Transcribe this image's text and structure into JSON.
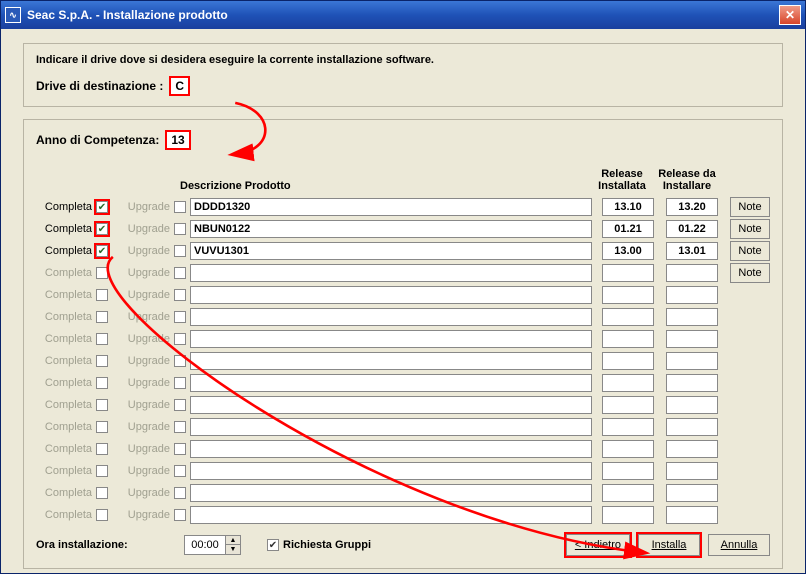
{
  "window": {
    "title": "Seac S.p.A.        -    Installazione prodotto",
    "icon": "app-icon"
  },
  "instruction": "Indicare il drive dove si desidera eseguire la corrente installazione software.",
  "drive": {
    "label": "Drive di destinazione :",
    "value": "C"
  },
  "anno": {
    "label": "Anno di Competenza:",
    "value": "13"
  },
  "headers": {
    "desc": "Descrizione Prodotto",
    "releaseInstallata": "Release\nInstallata",
    "releaseDaInstallare": "Release da\nInstallare"
  },
  "row_labels": {
    "completa": "Completa",
    "upgrade": "Upgrade",
    "note": "Note"
  },
  "rows": [
    {
      "completa": true,
      "completa_red": true,
      "upgrade": false,
      "upgrade_disabled": true,
      "desc": "DDDD1320",
      "rel": "13.10",
      "relda": "13.20",
      "note": true,
      "enabled": true
    },
    {
      "completa": true,
      "completa_red": true,
      "upgrade": false,
      "upgrade_disabled": true,
      "desc": "NBUN0122",
      "rel": "01.21",
      "relda": "01.22",
      "note": true,
      "enabled": true
    },
    {
      "completa": true,
      "completa_red": true,
      "upgrade": false,
      "upgrade_disabled": true,
      "desc": "VUVU1301",
      "rel": "13.00",
      "relda": "13.01",
      "note": true,
      "enabled": true
    },
    {
      "completa": false,
      "upgrade": false,
      "desc": "",
      "rel": "",
      "relda": "",
      "note": true,
      "enabled": false
    },
    {
      "completa": false,
      "upgrade": false,
      "desc": "",
      "rel": "",
      "relda": "",
      "note": false,
      "enabled": false
    },
    {
      "completa": false,
      "upgrade": false,
      "desc": "",
      "rel": "",
      "relda": "",
      "note": false,
      "enabled": false
    },
    {
      "completa": false,
      "upgrade": false,
      "desc": "",
      "rel": "",
      "relda": "",
      "note": false,
      "enabled": false
    },
    {
      "completa": false,
      "upgrade": false,
      "desc": "",
      "rel": "",
      "relda": "",
      "note": false,
      "enabled": false
    },
    {
      "completa": false,
      "upgrade": false,
      "desc": "",
      "rel": "",
      "relda": "",
      "note": false,
      "enabled": false
    },
    {
      "completa": false,
      "upgrade": false,
      "desc": "",
      "rel": "",
      "relda": "",
      "note": false,
      "enabled": false
    },
    {
      "completa": false,
      "upgrade": false,
      "desc": "",
      "rel": "",
      "relda": "",
      "note": false,
      "enabled": false
    },
    {
      "completa": false,
      "upgrade": false,
      "desc": "",
      "rel": "",
      "relda": "",
      "note": false,
      "enabled": false
    },
    {
      "completa": false,
      "upgrade": false,
      "desc": "",
      "rel": "",
      "relda": "",
      "note": false,
      "enabled": false
    },
    {
      "completa": false,
      "upgrade": false,
      "desc": "",
      "rel": "",
      "relda": "",
      "note": false,
      "enabled": false
    },
    {
      "completa": false,
      "upgrade": false,
      "desc": "",
      "rel": "",
      "relda": "",
      "note": false,
      "enabled": false
    }
  ],
  "footer": {
    "ora_label": "Ora installazione:",
    "ora_value": "00:00",
    "richiesta_gruppi": "Richiesta Gruppi",
    "richiesta_checked": true,
    "indietro": "< Indietro",
    "installa": "Installa",
    "annulla": "Annulla"
  }
}
